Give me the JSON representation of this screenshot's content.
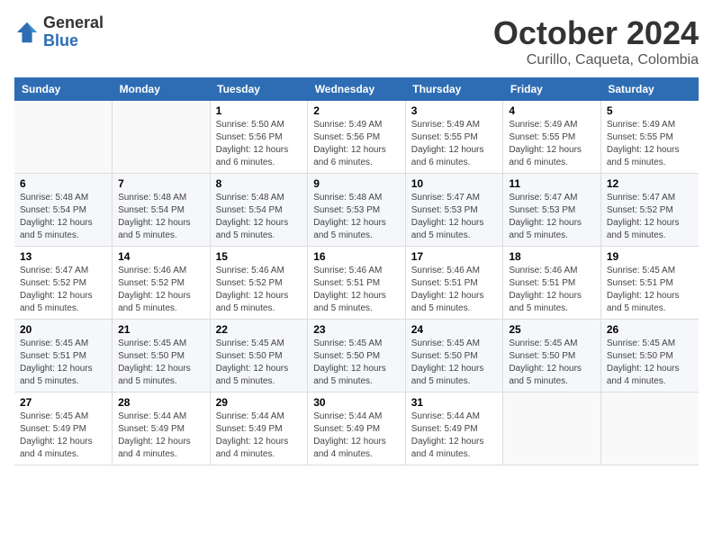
{
  "logo": {
    "general": "General",
    "blue": "Blue"
  },
  "title": {
    "month": "October 2024",
    "location": "Curillo, Caqueta, Colombia"
  },
  "headers": [
    "Sunday",
    "Monday",
    "Tuesday",
    "Wednesday",
    "Thursday",
    "Friday",
    "Saturday"
  ],
  "weeks": [
    [
      {
        "day": "",
        "info": ""
      },
      {
        "day": "",
        "info": ""
      },
      {
        "day": "1",
        "info": "Sunrise: 5:50 AM\nSunset: 5:56 PM\nDaylight: 12 hours and 6 minutes."
      },
      {
        "day": "2",
        "info": "Sunrise: 5:49 AM\nSunset: 5:56 PM\nDaylight: 12 hours and 6 minutes."
      },
      {
        "day": "3",
        "info": "Sunrise: 5:49 AM\nSunset: 5:55 PM\nDaylight: 12 hours and 6 minutes."
      },
      {
        "day": "4",
        "info": "Sunrise: 5:49 AM\nSunset: 5:55 PM\nDaylight: 12 hours and 6 minutes."
      },
      {
        "day": "5",
        "info": "Sunrise: 5:49 AM\nSunset: 5:55 PM\nDaylight: 12 hours and 5 minutes."
      }
    ],
    [
      {
        "day": "6",
        "info": "Sunrise: 5:48 AM\nSunset: 5:54 PM\nDaylight: 12 hours and 5 minutes."
      },
      {
        "day": "7",
        "info": "Sunrise: 5:48 AM\nSunset: 5:54 PM\nDaylight: 12 hours and 5 minutes."
      },
      {
        "day": "8",
        "info": "Sunrise: 5:48 AM\nSunset: 5:54 PM\nDaylight: 12 hours and 5 minutes."
      },
      {
        "day": "9",
        "info": "Sunrise: 5:48 AM\nSunset: 5:53 PM\nDaylight: 12 hours and 5 minutes."
      },
      {
        "day": "10",
        "info": "Sunrise: 5:47 AM\nSunset: 5:53 PM\nDaylight: 12 hours and 5 minutes."
      },
      {
        "day": "11",
        "info": "Sunrise: 5:47 AM\nSunset: 5:53 PM\nDaylight: 12 hours and 5 minutes."
      },
      {
        "day": "12",
        "info": "Sunrise: 5:47 AM\nSunset: 5:52 PM\nDaylight: 12 hours and 5 minutes."
      }
    ],
    [
      {
        "day": "13",
        "info": "Sunrise: 5:47 AM\nSunset: 5:52 PM\nDaylight: 12 hours and 5 minutes."
      },
      {
        "day": "14",
        "info": "Sunrise: 5:46 AM\nSunset: 5:52 PM\nDaylight: 12 hours and 5 minutes."
      },
      {
        "day": "15",
        "info": "Sunrise: 5:46 AM\nSunset: 5:52 PM\nDaylight: 12 hours and 5 minutes."
      },
      {
        "day": "16",
        "info": "Sunrise: 5:46 AM\nSunset: 5:51 PM\nDaylight: 12 hours and 5 minutes."
      },
      {
        "day": "17",
        "info": "Sunrise: 5:46 AM\nSunset: 5:51 PM\nDaylight: 12 hours and 5 minutes."
      },
      {
        "day": "18",
        "info": "Sunrise: 5:46 AM\nSunset: 5:51 PM\nDaylight: 12 hours and 5 minutes."
      },
      {
        "day": "19",
        "info": "Sunrise: 5:45 AM\nSunset: 5:51 PM\nDaylight: 12 hours and 5 minutes."
      }
    ],
    [
      {
        "day": "20",
        "info": "Sunrise: 5:45 AM\nSunset: 5:51 PM\nDaylight: 12 hours and 5 minutes."
      },
      {
        "day": "21",
        "info": "Sunrise: 5:45 AM\nSunset: 5:50 PM\nDaylight: 12 hours and 5 minutes."
      },
      {
        "day": "22",
        "info": "Sunrise: 5:45 AM\nSunset: 5:50 PM\nDaylight: 12 hours and 5 minutes."
      },
      {
        "day": "23",
        "info": "Sunrise: 5:45 AM\nSunset: 5:50 PM\nDaylight: 12 hours and 5 minutes."
      },
      {
        "day": "24",
        "info": "Sunrise: 5:45 AM\nSunset: 5:50 PM\nDaylight: 12 hours and 5 minutes."
      },
      {
        "day": "25",
        "info": "Sunrise: 5:45 AM\nSunset: 5:50 PM\nDaylight: 12 hours and 5 minutes."
      },
      {
        "day": "26",
        "info": "Sunrise: 5:45 AM\nSunset: 5:50 PM\nDaylight: 12 hours and 4 minutes."
      }
    ],
    [
      {
        "day": "27",
        "info": "Sunrise: 5:45 AM\nSunset: 5:49 PM\nDaylight: 12 hours and 4 minutes."
      },
      {
        "day": "28",
        "info": "Sunrise: 5:44 AM\nSunset: 5:49 PM\nDaylight: 12 hours and 4 minutes."
      },
      {
        "day": "29",
        "info": "Sunrise: 5:44 AM\nSunset: 5:49 PM\nDaylight: 12 hours and 4 minutes."
      },
      {
        "day": "30",
        "info": "Sunrise: 5:44 AM\nSunset: 5:49 PM\nDaylight: 12 hours and 4 minutes."
      },
      {
        "day": "31",
        "info": "Sunrise: 5:44 AM\nSunset: 5:49 PM\nDaylight: 12 hours and 4 minutes."
      },
      {
        "day": "",
        "info": ""
      },
      {
        "day": "",
        "info": ""
      }
    ]
  ]
}
